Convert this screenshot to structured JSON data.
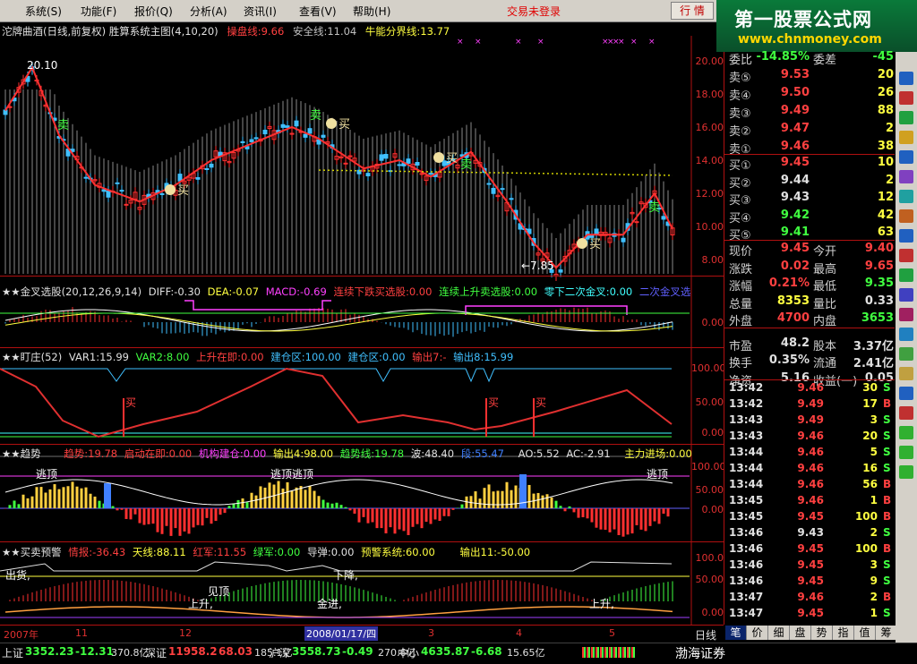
{
  "menu": [
    "系统(S)",
    "功能(F)",
    "报价(Q)",
    "分析(A)",
    "资讯(I)",
    "查看(V)",
    "帮助(H)"
  ],
  "trade_status": "交易未登录",
  "quote_button": "行 情",
  "logo": {
    "title": "第一股票公式网",
    "url": "www.chnmoney.com"
  },
  "chart_header": {
    "name": "沱牌曲酒(日线,前复权) 胜算系统主图(4,10,20)",
    "l1": "操盘线:9.66",
    "l2": "安全线:11.04",
    "l3": "牛能分界线:13.77"
  },
  "price_axis": [
    "20.00",
    "18.00",
    "16.00",
    "14.00",
    "12.00",
    "10.00",
    "8.00"
  ],
  "annotations": {
    "high": "20.10",
    "low": "←7.85",
    "buy": "买",
    "sell": "卖"
  },
  "ind1": {
    "title": "★★金叉选股(20,12,26,9,14)",
    "diff": "DIFF:-0.30",
    "dea": "DEA:-0.07",
    "macd": "MACD:-0.69",
    "a": "连续下跌买选股:0.00",
    "b": "连续上升卖选股:0.00",
    "c": "零下二次金叉:0.00",
    "d": "二次金叉选",
    "axis": [
      "0.00"
    ]
  },
  "ind2": {
    "title": "★★盯庄(52)",
    "v1": "VAR1:15.99",
    "v2": "VAR2:8.00",
    "v3": "上升在即:0.00",
    "v4": "建仓区:100.00",
    "v5": "建仓区:0.00",
    "v6": "输出7:-",
    "v7": "输出8:15.99",
    "axis": [
      "100.00",
      "50.00",
      "0.00"
    ],
    "buy": "买"
  },
  "ind3": {
    "title": "★★趋势",
    "v1": "趋势:19.78",
    "v2": "启动在即:0.00",
    "v3": "机构建仓:0.00",
    "v4": "输出4:98.00",
    "v5": "趋势线:19.78",
    "v6": "波:48.40",
    "v7": "段:55.47",
    "v8": "AO:5.52",
    "v9": "AC:-2.91",
    "v10": "主力进场:0.00",
    "axis": [
      "100.00",
      "50.00",
      "0.00"
    ],
    "top": "逃顶",
    "top2": "逃顶逃顶"
  },
  "ind4": {
    "title": "★★买卖预警",
    "v1": "情报:-36.43",
    "v2": "天线:88.11",
    "v3": "红军:11.55",
    "v4": "绿军:0.00",
    "v5": "导弹:0.00",
    "v6": "预警系统:60.00",
    "v7": "输出11:-50.00",
    "axis": [
      "100.0",
      "50.00",
      "0.00"
    ],
    "t1": "出货,",
    "t2": "见顶",
    "t3": "上升,",
    "t4": "下降,",
    "t5": "金进,",
    "t6": "上升,"
  },
  "time_axis": {
    "y": "2007年",
    "m1": "11",
    "m2": "12",
    "date": "2008/01/17/四",
    "m3": "3",
    "m4": "4",
    "m5": "5",
    "period": "日线"
  },
  "order_book": {
    "top": {
      "l": "委比",
      "v": "-14.85%",
      "l2": "委差",
      "v2": "-45"
    },
    "sells": [
      {
        "l": "卖⑤",
        "p": "9.53",
        "q": "20"
      },
      {
        "l": "卖④",
        "p": "9.50",
        "q": "26"
      },
      {
        "l": "卖③",
        "p": "9.49",
        "q": "88"
      },
      {
        "l": "卖②",
        "p": "9.47",
        "q": "2"
      },
      {
        "l": "卖①",
        "p": "9.46",
        "q": "38"
      }
    ],
    "buys": [
      {
        "l": "买①",
        "p": "9.45",
        "q": "10"
      },
      {
        "l": "买②",
        "p": "9.44",
        "q": "2"
      },
      {
        "l": "买③",
        "p": "9.43",
        "q": "12"
      },
      {
        "l": "买④",
        "p": "9.42",
        "q": "42"
      },
      {
        "l": "买⑤",
        "p": "9.41",
        "q": "63"
      }
    ]
  },
  "stats": [
    {
      "a": "现价",
      "b": "9.45",
      "c": "今开",
      "d": "9.40"
    },
    {
      "a": "涨跌",
      "b": "0.02",
      "c": "最高",
      "d": "9.65"
    },
    {
      "a": "涨幅",
      "b": "0.21%",
      "c": "最低",
      "d": "9.35"
    },
    {
      "a": "总量",
      "b": "8353",
      "c": "量比",
      "d": "0.33"
    },
    {
      "a": "外盘",
      "b": "4700",
      "c": "内盘",
      "d": "3653"
    },
    {
      "a": "市盈",
      "b": "48.2",
      "c": "股本",
      "d": "3.37亿"
    },
    {
      "a": "换手",
      "b": "0.35%",
      "c": "流通",
      "d": "2.41亿"
    },
    {
      "a": "净资",
      "b": "5.16",
      "c": "收益(一)",
      "d": "0.05"
    }
  ],
  "ticks": [
    {
      "t": "13:42",
      "p": "9.46",
      "v": "30",
      "s": "S"
    },
    {
      "t": "13:42",
      "p": "9.49",
      "v": "17",
      "s": "B"
    },
    {
      "t": "13:43",
      "p": "9.49",
      "v": "3",
      "s": "S"
    },
    {
      "t": "13:43",
      "p": "9.46",
      "v": "20",
      "s": "S"
    },
    {
      "t": "13:44",
      "p": "9.46",
      "v": "5",
      "s": "S"
    },
    {
      "t": "13:44",
      "p": "9.46",
      "v": "16",
      "s": "S"
    },
    {
      "t": "13:44",
      "p": "9.46",
      "v": "56",
      "s": "B"
    },
    {
      "t": "13:45",
      "p": "9.46",
      "v": "1",
      "s": "B"
    },
    {
      "t": "13:45",
      "p": "9.45",
      "v": "100",
      "s": "B"
    },
    {
      "t": "13:46",
      "p": "9.43",
      "v": "2",
      "s": "S"
    },
    {
      "t": "13:46",
      "p": "9.45",
      "v": "100",
      "s": "B"
    },
    {
      "t": "13:46",
      "p": "9.45",
      "v": "3",
      "s": "S"
    },
    {
      "t": "13:46",
      "p": "9.45",
      "v": "9",
      "s": "S"
    },
    {
      "t": "13:47",
      "p": "9.46",
      "v": "2",
      "s": "B"
    },
    {
      "t": "13:47",
      "p": "9.45",
      "v": "1",
      "s": "S"
    }
  ],
  "right_tabs": [
    "笔",
    "价",
    "细",
    "盘",
    "势",
    "指",
    "值",
    "筹"
  ],
  "bottom": [
    {
      "n": "上证",
      "v": "3352.23",
      "c": "-12.31",
      "a": "370.8亿"
    },
    {
      "n": "深证",
      "v": "11958.2",
      "c": "68.03",
      "a": "185.1亿"
    },
    {
      "n": "沪深",
      "v": "3558.73",
      "c": "-0.49",
      "a": "270.6亿"
    },
    {
      "n": "中小",
      "v": "4635.87",
      "c": "-6.68",
      "a": "15.65亿"
    }
  ],
  "broker": "渤海证券"
}
